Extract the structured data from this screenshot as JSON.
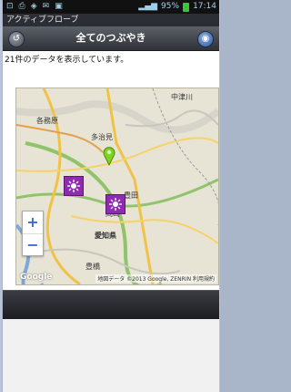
{
  "status_bar": {
    "left_icons": [
      "notification-icon",
      "usb-icon",
      "android-icon",
      "mail-icon",
      "image-icon"
    ],
    "signal_text": "95%",
    "time": "17:14"
  },
  "app_title": "アクティブフローブ",
  "header": {
    "title": "全てのつぶやき",
    "left_button_icon": "back-arrow-icon",
    "right_button_icon": "info-icon"
  },
  "info_text": "21件のデータを表示しています。",
  "map": {
    "labels": [
      "中津川",
      "各務原",
      "多治見",
      "豊田",
      "岡崎",
      "愛知県",
      "豊橋"
    ],
    "zoom_in": "+",
    "zoom_out": "−",
    "logo": "Google",
    "attribution": "地図データ ©2013 Google, ZENRIN 利用規約",
    "markers": [
      "purple-marker",
      "purple-marker",
      "green-pin"
    ]
  },
  "colors": {
    "header": "#2f3237",
    "marker": "#8e2bb0",
    "pin": "#7ed321",
    "zoom_text": "#3c6ad6"
  }
}
